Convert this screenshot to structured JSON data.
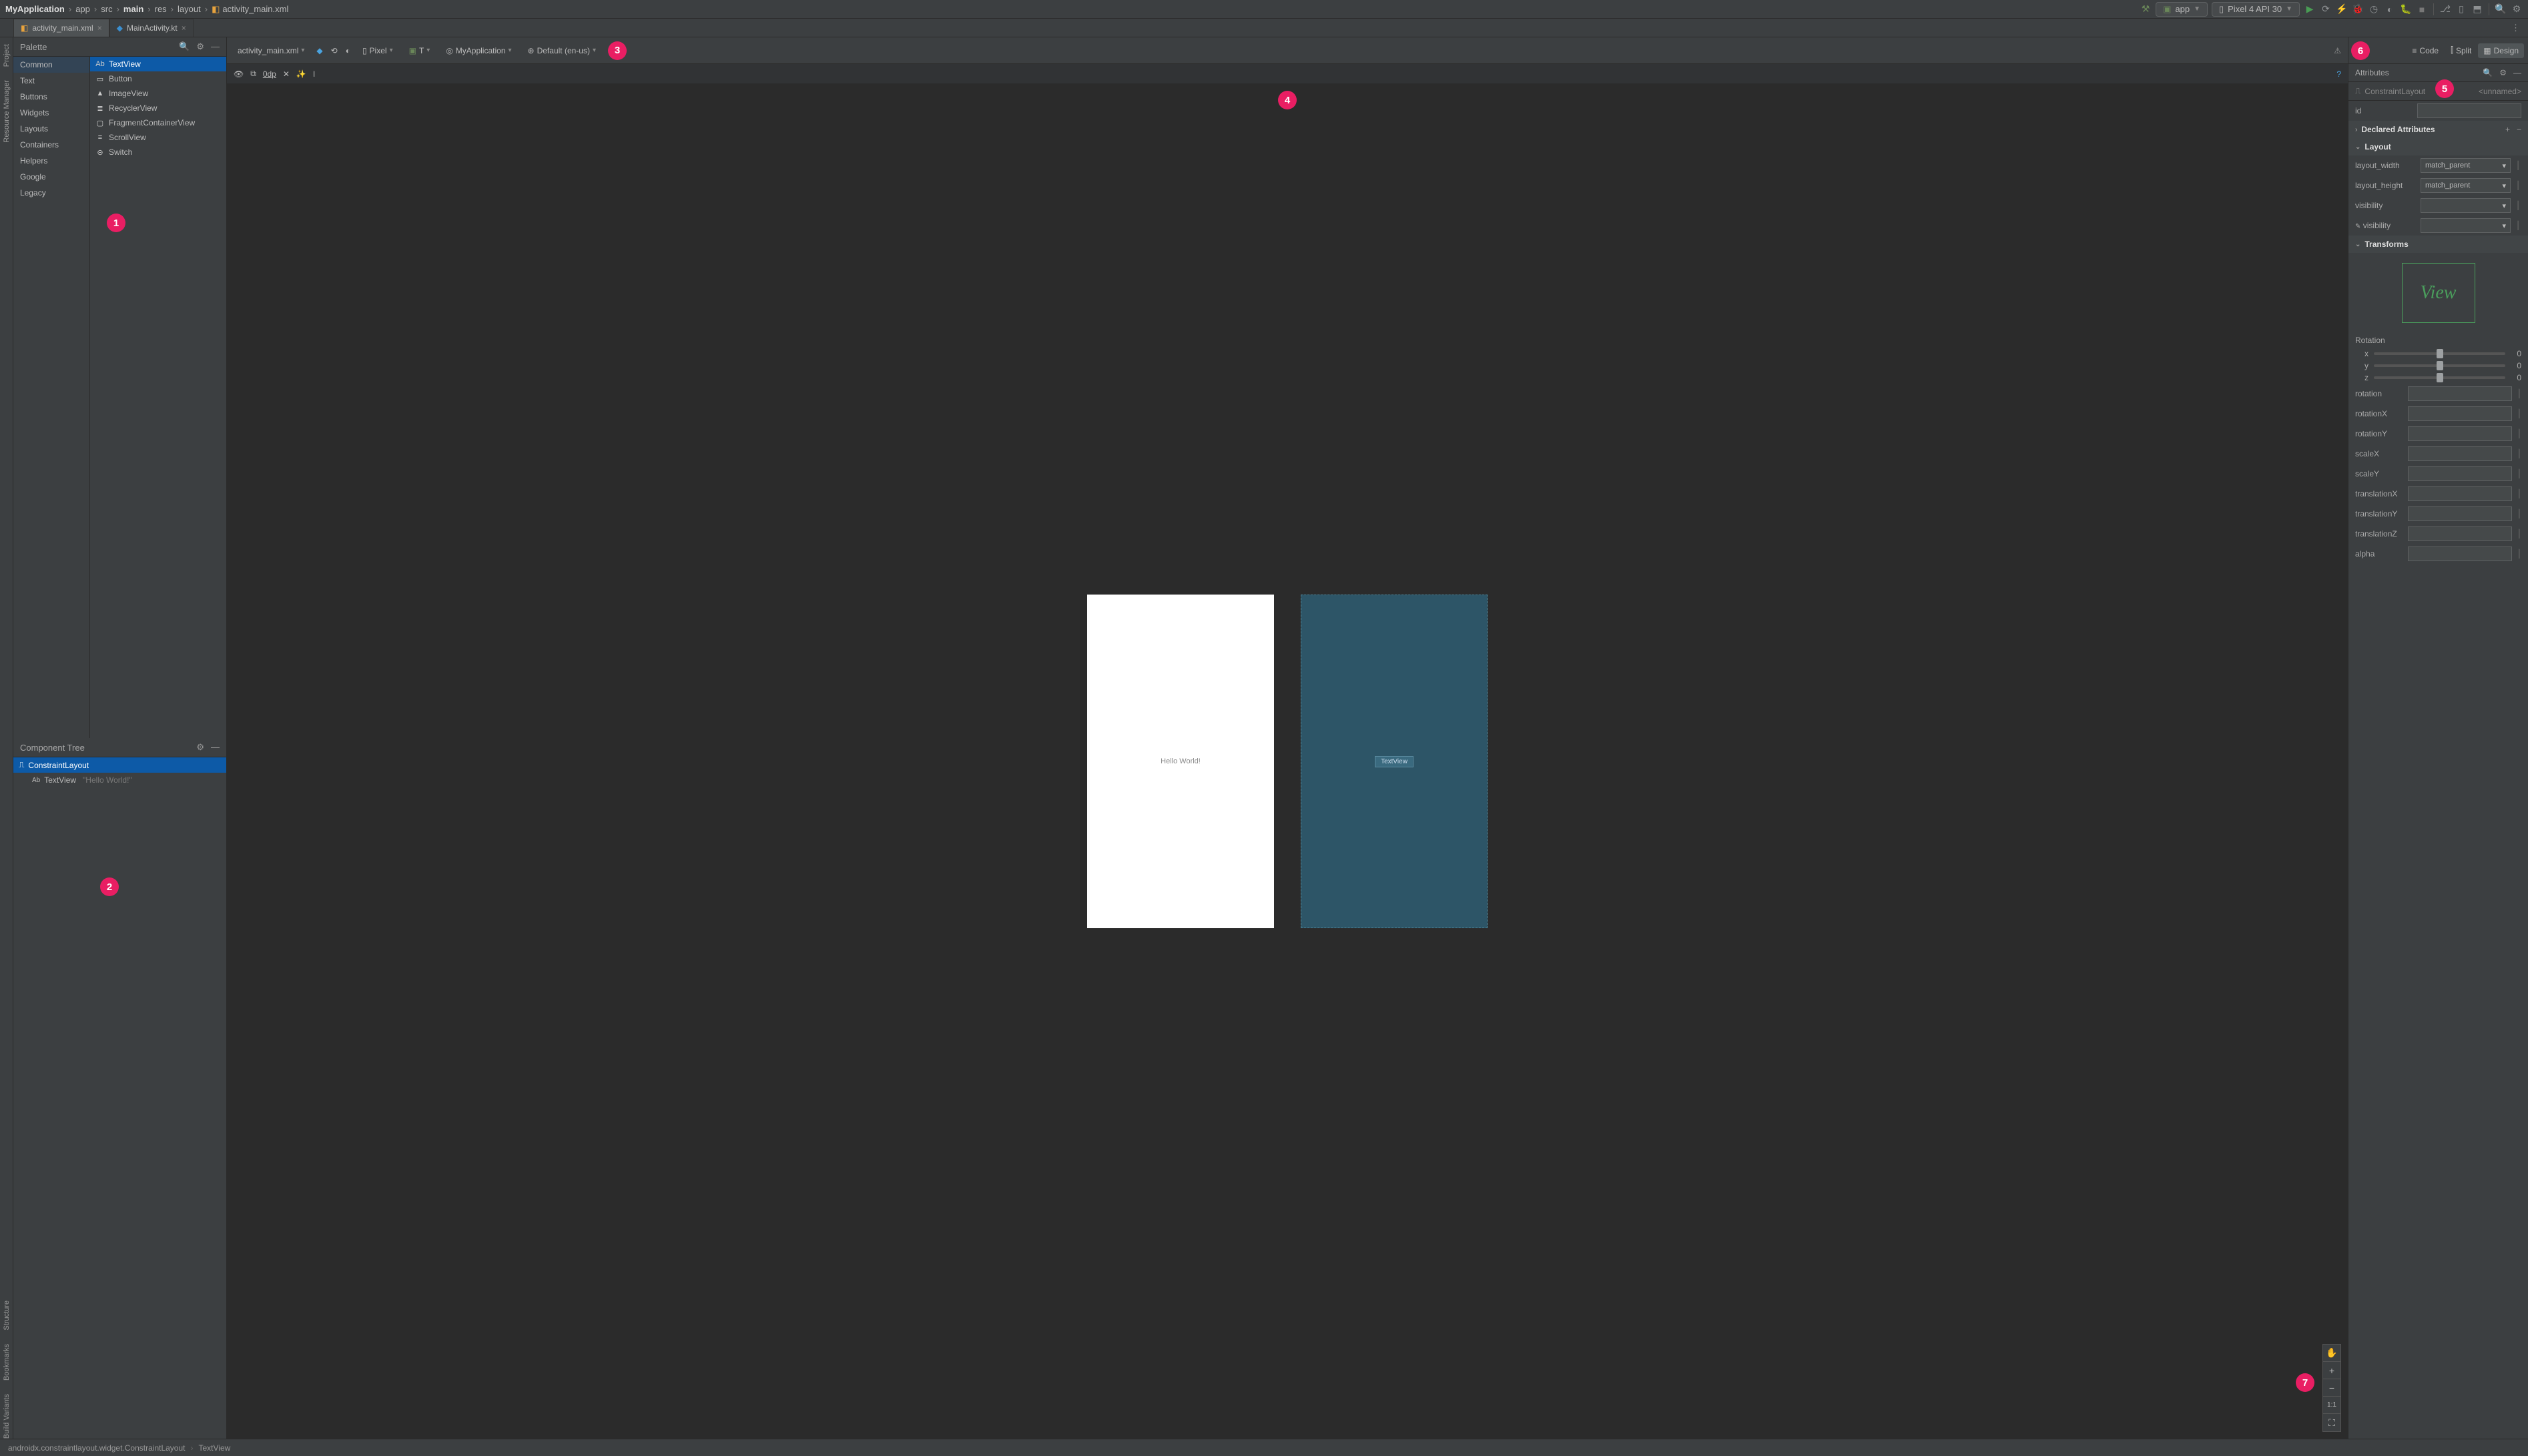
{
  "breadcrumbs": [
    "MyApplication",
    "app",
    "src",
    "main",
    "res",
    "layout",
    "activity_main.xml"
  ],
  "run": {
    "app": "app",
    "device": "Pixel 4 API 30"
  },
  "tabs": {
    "t0": {
      "label": "activity_main.xml"
    },
    "t1": {
      "label": "MainActivity.kt"
    }
  },
  "rails": {
    "project": "Project",
    "resource": "Resource Manager",
    "structure": "Structure",
    "bookmarks": "Bookmarks",
    "build": "Build Variants"
  },
  "palette": {
    "title": "Palette",
    "cats": [
      "Common",
      "Text",
      "Buttons",
      "Widgets",
      "Layouts",
      "Containers",
      "Helpers",
      "Google",
      "Legacy"
    ],
    "items": [
      "TextView",
      "Button",
      "ImageView",
      "RecyclerView",
      "FragmentContainerView",
      "ScrollView",
      "Switch"
    ]
  },
  "componentTree": {
    "title": "Component Tree",
    "root": "ConstraintLayout",
    "childType": "TextView",
    "childText": "\"Hello World!\""
  },
  "designToolbar": {
    "file": "activity_main.xml",
    "deviceLabel": "Pixel",
    "themeLabel": "T",
    "appLabel": "MyApplication",
    "localeLabel": "Default (en-us)",
    "marginLabel": "0dp"
  },
  "surface": {
    "hello": "Hello World!",
    "blueprintLabel": "TextView",
    "zoom": {
      "pan": "✋",
      "in": "+",
      "out": "−",
      "fit": "1:1",
      "expand": "⛶"
    }
  },
  "viewSwitch": {
    "code": "Code",
    "split": "Split",
    "design": "Design"
  },
  "attributes": {
    "title": "Attributes",
    "selectedType": "ConstraintLayout",
    "unnamed": "<unnamed>",
    "idLabel": "id",
    "declared": "Declared Attributes",
    "layout": "Layout",
    "layout_width_label": "layout_width",
    "layout_width": "match_parent",
    "layout_height_label": "layout_height",
    "layout_height": "match_parent",
    "visibility_label": "visibility",
    "visibility2_label": "visibility",
    "transforms": "Transforms",
    "viewPh": "View",
    "rotation": "Rotation",
    "x": "x",
    "y": "y",
    "z": "z",
    "zero": "0",
    "rows": {
      "rotation": "rotation",
      "rotationX": "rotationX",
      "rotationY": "rotationY",
      "scaleX": "scaleX",
      "scaleY": "scaleY",
      "translationX": "translationX",
      "translationY": "translationY",
      "translationZ": "translationZ",
      "alpha": "alpha"
    }
  },
  "markers": {
    "1": "1",
    "2": "2",
    "3": "3",
    "4": "4",
    "5": "5",
    "6": "6",
    "7": "7"
  },
  "status": {
    "type": "androidx.constraintlayout.widget.ConstraintLayout",
    "sel": "TextView"
  }
}
